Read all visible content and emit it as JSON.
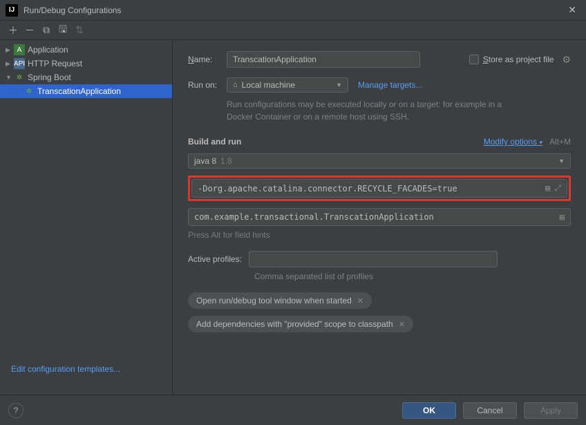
{
  "titlebar": {
    "title": "Run/Debug Configurations"
  },
  "sidebar": {
    "items": [
      {
        "label": "Application"
      },
      {
        "label": "HTTP Request"
      },
      {
        "label": "Spring Boot"
      }
    ],
    "selected": "TranscationApplication",
    "edit_templates": "Edit configuration templates..."
  },
  "form": {
    "name_label": "Name:",
    "name_value": "TranscationApplication",
    "store_label": "Store as project file",
    "runon_label": "Run on:",
    "runon_value": "Local machine",
    "manage_targets": "Manage targets...",
    "runon_hint": "Run configurations may be executed locally or on a target: for example in a Docker Container or on a remote host using SSH.",
    "build_run": "Build and run",
    "modify_options": "Modify options",
    "modify_shortcut": "Alt+M",
    "jdk_label": "java 8",
    "jdk_version": "1.8",
    "vm_options": "-Dorg.apache.catalina.connector.RECYCLE_FACADES=true",
    "main_class": "com.example.transactional.TranscationApplication",
    "hint_alt": "Press Alt for field hints",
    "active_profiles_label": "Active profiles:",
    "active_profiles_value": "",
    "comma_hint": "Comma separated list of profiles",
    "chip1": "Open run/debug tool window when started",
    "chip2": "Add dependencies with \"provided\" scope to classpath"
  },
  "footer": {
    "ok": "OK",
    "cancel": "Cancel",
    "apply": "Apply"
  }
}
